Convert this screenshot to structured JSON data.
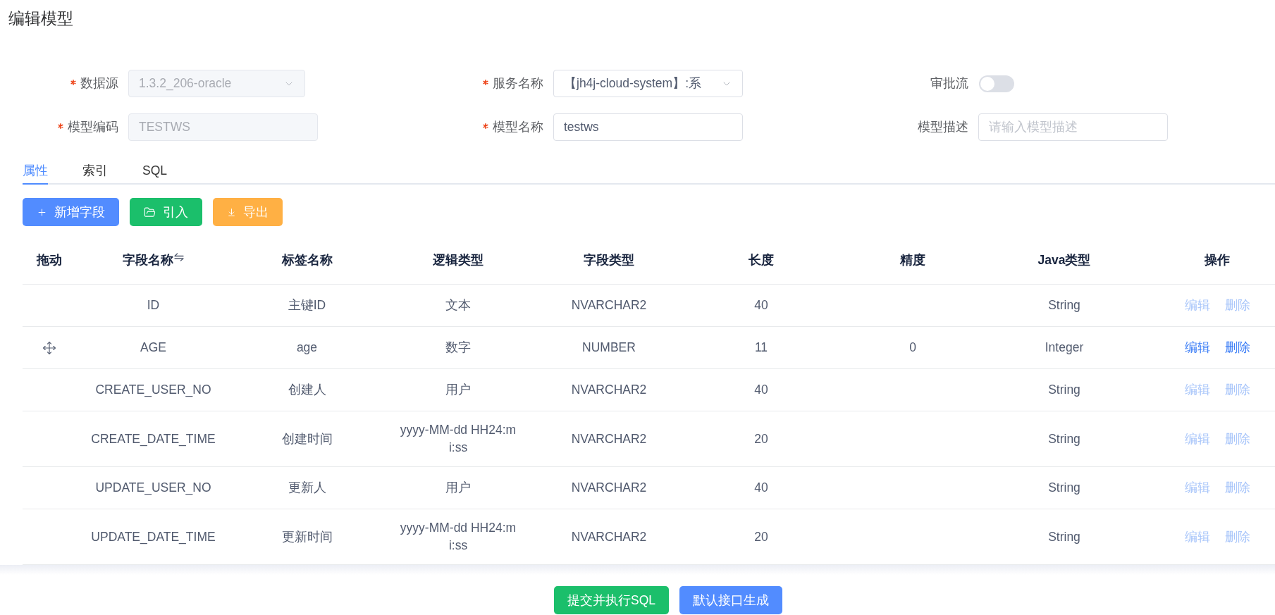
{
  "page": {
    "title": "编辑模型"
  },
  "form": {
    "fields": [
      {
        "kind": "select",
        "label": "数据源",
        "required": true,
        "disabled": true,
        "value": "1.3.2_206-oracle"
      },
      {
        "kind": "select",
        "label": "服务名称",
        "required": true,
        "disabled": false,
        "value": "【jh4j-cloud-system】:系"
      },
      {
        "kind": "switch",
        "label": "审批流",
        "required": false,
        "on": false
      },
      {
        "kind": "input",
        "label": "模型编码",
        "required": true,
        "disabled": true,
        "value": "TESTWS"
      },
      {
        "kind": "input",
        "label": "模型名称",
        "required": true,
        "disabled": false,
        "value": "testws"
      },
      {
        "kind": "input",
        "label": "模型描述",
        "required": false,
        "placeholder": "请输入模型描述"
      }
    ]
  },
  "tabs": [
    {
      "label": "属性",
      "selected": true
    },
    {
      "label": "索引",
      "selected": false
    },
    {
      "label": "SQL",
      "selected": false
    }
  ],
  "toolbar": [
    {
      "kind": "add",
      "label": "新增字段"
    },
    {
      "kind": "import",
      "label": "引入"
    },
    {
      "kind": "export",
      "label": "导出"
    }
  ],
  "table": {
    "columns": [
      {
        "label": "拖动",
        "sortable": false
      },
      {
        "label": "字段名称",
        "sortable": true
      },
      {
        "label": "标签名称",
        "sortable": false
      },
      {
        "label": "逻辑类型",
        "sortable": false
      },
      {
        "label": "字段类型",
        "sortable": false
      },
      {
        "label": "长度",
        "sortable": false
      },
      {
        "label": "精度",
        "sortable": false
      },
      {
        "label": "Java类型",
        "sortable": false
      },
      {
        "label": "操作",
        "sortable": false
      }
    ],
    "rows": [
      {
        "draggable": false,
        "field_name": "ID",
        "label_name": "主键ID",
        "logic_type": "文本",
        "field_type": "NVARCHAR2",
        "length": "40",
        "java_type": "String",
        "actions": [
          {
            "label": "编辑",
            "disabled": true
          },
          {
            "label": "删除",
            "disabled": true
          }
        ]
      },
      {
        "draggable": true,
        "field_name": "AGE",
        "label_name": "age",
        "logic_type": "数字",
        "field_type": "NUMBER",
        "length": "11",
        "precision": "0",
        "java_type": "Integer",
        "actions": [
          {
            "label": "编辑",
            "disabled": false
          },
          {
            "label": "删除",
            "disabled": false
          }
        ]
      },
      {
        "draggable": false,
        "field_name": "CREATE_USER_NO",
        "label_name": "创建人",
        "logic_type": "用户",
        "field_type": "NVARCHAR2",
        "length": "40",
        "java_type": "String",
        "actions": [
          {
            "label": "编辑",
            "disabled": true
          },
          {
            "label": "删除",
            "disabled": true
          }
        ]
      },
      {
        "draggable": false,
        "field_name": "CREATE_DATE_TIME",
        "label_name": "创建时间",
        "logic_type": "yyyy-MM-dd HH24:mi:ss",
        "field_type": "NVARCHAR2",
        "length": "20",
        "java_type": "String",
        "actions": [
          {
            "label": "编辑",
            "disabled": true
          },
          {
            "label": "删除",
            "disabled": true
          }
        ]
      },
      {
        "draggable": false,
        "field_name": "UPDATE_USER_NO",
        "label_name": "更新人",
        "logic_type": "用户",
        "field_type": "NVARCHAR2",
        "length": "40",
        "java_type": "String",
        "actions": [
          {
            "label": "编辑",
            "disabled": true
          },
          {
            "label": "删除",
            "disabled": true
          }
        ]
      },
      {
        "draggable": false,
        "field_name": "UPDATE_DATE_TIME",
        "label_name": "更新时间",
        "logic_type": "yyyy-MM-dd HH24:mi:ss",
        "field_type": "NVARCHAR2",
        "length": "20",
        "java_type": "String",
        "actions": [
          {
            "label": "编辑",
            "disabled": true
          },
          {
            "label": "删除",
            "disabled": true
          }
        ]
      }
    ]
  },
  "footer": {
    "buttons": [
      {
        "kind": "success",
        "label": "提交并执行SQL"
      },
      {
        "kind": "primary",
        "label": "默认接口生成"
      }
    ]
  }
}
